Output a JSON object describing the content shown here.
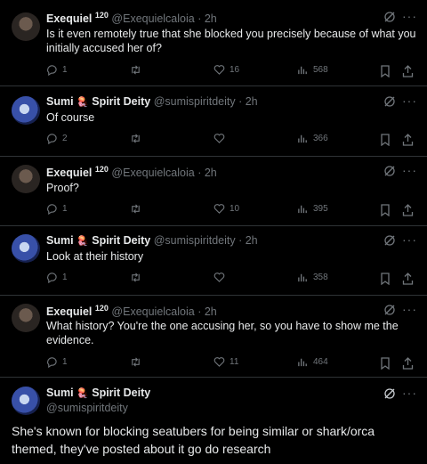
{
  "replies": [
    {
      "name": "Exequiel",
      "name_sup": "120",
      "handle": "@Exequielcaloia",
      "time": "· 2h",
      "text": "Is it even remotely true that she blocked you precisely because of what you initially accused her of?",
      "replies": "1",
      "retweets": "",
      "likes": "16",
      "views": "568"
    },
    {
      "name": "Sumi",
      "name_emoji": "🪼",
      "name_rest": "Spirit Deity",
      "handle": "@sumispiritdeity",
      "time": "· 2h",
      "text": "Of course",
      "replies": "2",
      "retweets": "",
      "likes": "",
      "views": "366"
    },
    {
      "name": "Exequiel",
      "name_sup": "120",
      "handle": "@Exequielcaloia",
      "time": "· 2h",
      "text": "Proof?",
      "replies": "1",
      "retweets": "",
      "likes": "10",
      "views": "395"
    },
    {
      "name": "Sumi",
      "name_emoji": "🪼",
      "name_rest": "Spirit Deity",
      "handle": "@sumispiritdeity",
      "time": "· 2h",
      "text": "Look at their history",
      "replies": "1",
      "retweets": "",
      "likes": "",
      "views": "358"
    },
    {
      "name": "Exequiel",
      "name_sup": "120",
      "handle": "@Exequielcaloia",
      "time": "· 2h",
      "text": "What history? You're the one accusing her, so you have to show me the evidence.",
      "replies": "1",
      "retweets": "",
      "likes": "11",
      "views": "464"
    }
  ],
  "main_tweet": {
    "name": "Sumi",
    "name_emoji": "🪼",
    "name_rest": "Spirit Deity",
    "handle": "@sumispiritdeity",
    "text": "She's known for blocking seatubers for being similar or shark/orca themed, they've posted about it go do research"
  },
  "more_label": "···",
  "icons": [
    "grok-icon",
    "more-icon",
    "reply-icon",
    "retweet-icon",
    "like-icon",
    "views-icon",
    "bookmark-icon",
    "share-icon"
  ],
  "colors": {
    "background": "#000000",
    "text": "#e7e9ea",
    "muted": "#71767b",
    "divider": "#2f3336"
  }
}
